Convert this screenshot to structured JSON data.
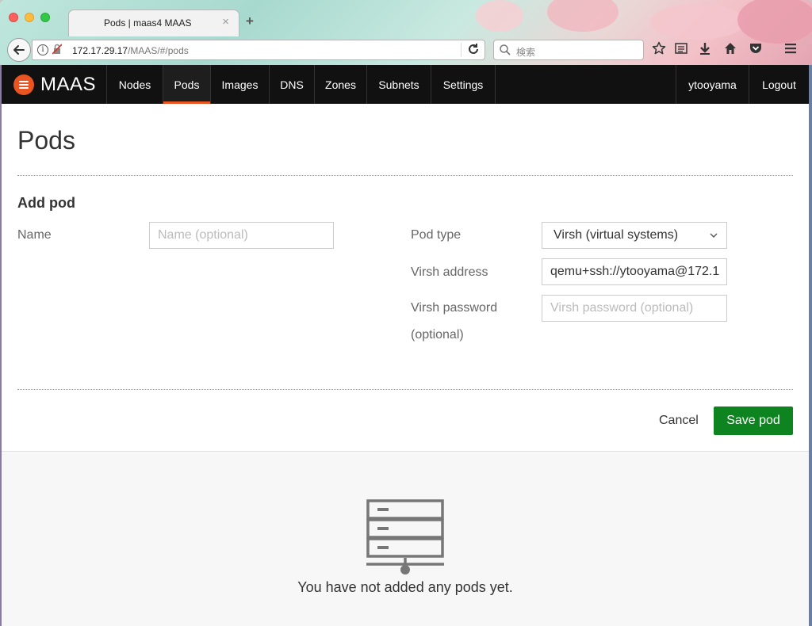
{
  "browser": {
    "tab_title": "Pods | maas4 MAAS",
    "tab_close": "×",
    "tab_new": "+",
    "url_host": "172.17.29.17",
    "url_path": "/MAAS/#/pods",
    "search_placeholder": "検索"
  },
  "nav": {
    "brand": "MAAS",
    "items": [
      {
        "label": "Nodes"
      },
      {
        "label": "Pods"
      },
      {
        "label": "Images"
      },
      {
        "label": "DNS"
      },
      {
        "label": "Zones"
      },
      {
        "label": "Subnets"
      },
      {
        "label": "Settings"
      }
    ],
    "active": "Pods",
    "user": "ytooyama",
    "logout": "Logout",
    "accent_color": "#e95420"
  },
  "page": {
    "title": "Pods",
    "form": {
      "section_title": "Add pod",
      "name_label": "Name",
      "name_placeholder": "Name (optional)",
      "pod_type_label": "Pod type",
      "pod_type_value": "Virsh (virtual systems)",
      "virsh_address_label": "Virsh address",
      "virsh_address_value": "qemu+ssh://ytooyama@172.1",
      "virsh_password_label_line1": "Virsh password",
      "virsh_password_label_line2": "(optional)",
      "virsh_password_placeholder": "Virsh password (optional)",
      "cancel_label": "Cancel",
      "save_label": "Save pod",
      "save_color": "#0e8420"
    },
    "empty_state": {
      "message": "You have not added any pods yet."
    }
  }
}
